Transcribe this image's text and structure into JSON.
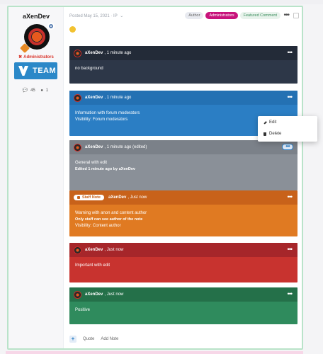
{
  "author": {
    "name": "aXenDev",
    "group": "Administrators",
    "team_logo_text": "TEAM",
    "stats": {
      "posts": "45",
      "reputation": "1"
    }
  },
  "post": {
    "meta": "Posted May 15, 2021",
    "meta_share": "· IP",
    "badges": [
      "Author",
      "Administrators",
      "Featured Comment"
    ],
    "more_label": "•••"
  },
  "notes": [
    {
      "author": "aXenDev",
      "time": ", 1 minute ago",
      "body": "no background"
    },
    {
      "author": "aXenDev",
      "time": ", 1 minute ago",
      "body": "Information with forum moderators",
      "visibility": "Visibility: Forum moderators"
    },
    {
      "author": "aXenDev",
      "time": ", 1 minute ago (edited)",
      "body": "General with edit",
      "edited": "Edited 1 minute ago by aXenDev"
    },
    {
      "staff_label": "Staff Note",
      "author": "aXenDev",
      "time": ", Just now",
      "body": "Warning with anon and content author",
      "extra": "Only staff can see author of the note",
      "visibility": "Visibility: Content author"
    },
    {
      "author": "aXenDev",
      "time": ", Just now",
      "body": "Important with edit"
    },
    {
      "author": "aXenDev",
      "time": ", Just now",
      "body": "Positive"
    }
  ],
  "dropdown": {
    "edit": "Edit",
    "delete": "Delete"
  },
  "footer": {
    "quote": "Quote",
    "add_note": "Add Note"
  },
  "colors": {
    "dark": "#2d3748",
    "info": "#2b7ec4",
    "general": "#8a9098",
    "warning": "#e07a22",
    "important": "#c8332f",
    "positive": "#2f8b5d"
  }
}
